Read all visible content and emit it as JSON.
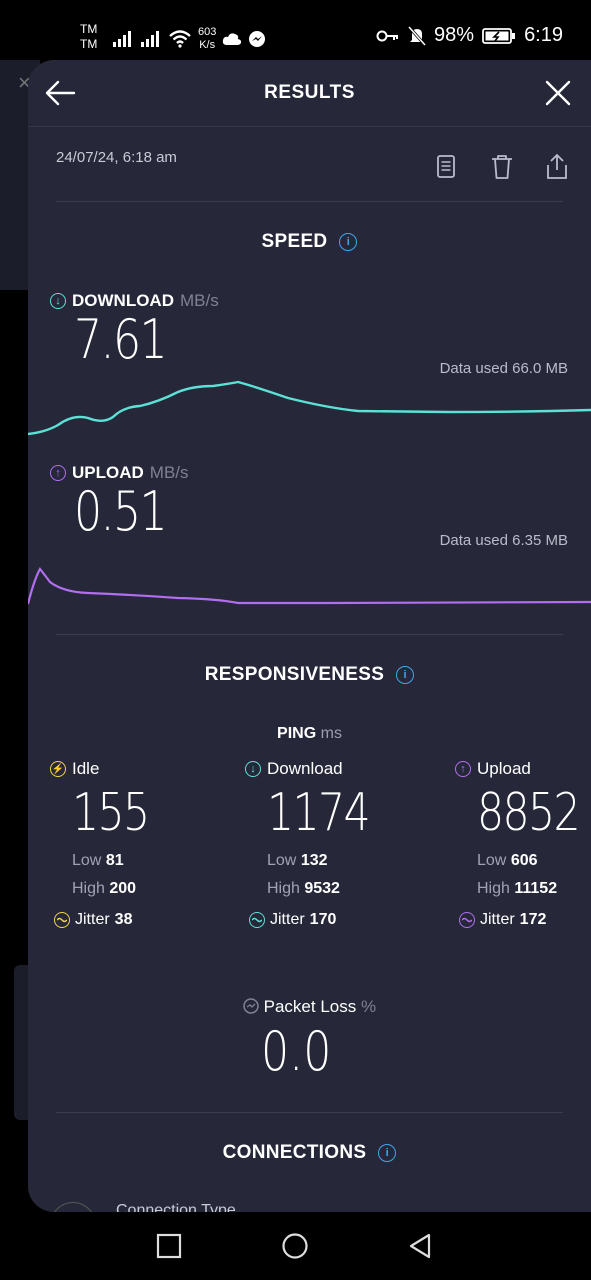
{
  "status_bar": {
    "carrier_1": "TM",
    "carrier_2": "TM",
    "net_speed_value": "603",
    "net_speed_unit": "K/s",
    "battery": "98%",
    "time": "6:19"
  },
  "header": {
    "title": "RESULTS"
  },
  "result": {
    "date": "24/07/24, 6:18 am"
  },
  "speed": {
    "section_title": "SPEED",
    "download": {
      "label": "DOWNLOAD",
      "unit": "MB/s",
      "value": "7.61",
      "data_used": "Data used 66.0 MB"
    },
    "upload": {
      "label": "UPLOAD",
      "unit": "MB/s",
      "value": "0.51",
      "data_used": "Data used 6.35 MB"
    }
  },
  "responsiveness": {
    "section_title": "RESPONSIVENESS",
    "ping_label": "PING",
    "ping_unit": "ms",
    "idle": {
      "label": "Idle",
      "value": "155",
      "low_label": "Low",
      "low": "81",
      "high_label": "High",
      "high": "200",
      "jitter_label": "Jitter",
      "jitter": "38"
    },
    "download": {
      "label": "Download",
      "value": "1174",
      "low_label": "Low",
      "low": "132",
      "high_label": "High",
      "high": "9532",
      "jitter_label": "Jitter",
      "jitter": "170"
    },
    "upload": {
      "label": "Upload",
      "value": "8852",
      "low_label": "Low",
      "low": "606",
      "high_label": "High",
      "high": "11152",
      "jitter_label": "Jitter",
      "jitter": "172"
    },
    "packet_loss": {
      "label": "Packet Loss",
      "unit": "%",
      "value": "0.0"
    }
  },
  "connections": {
    "section_title": "CONNECTIONS",
    "connection_type_label": "Connection Type"
  },
  "colors": {
    "background": "#262839",
    "download_accent": "#5ce1d6",
    "upload_accent": "#b26ef0",
    "idle_accent": "#f2d34a",
    "info_blue": "#3ea5ee"
  },
  "icons": [
    "back-arrow-icon",
    "close-icon",
    "document-icon",
    "trash-icon",
    "share-icon",
    "info-icon",
    "download-icon",
    "upload-icon",
    "idle-icon",
    "jitter-icon",
    "packet-loss-icon"
  ]
}
